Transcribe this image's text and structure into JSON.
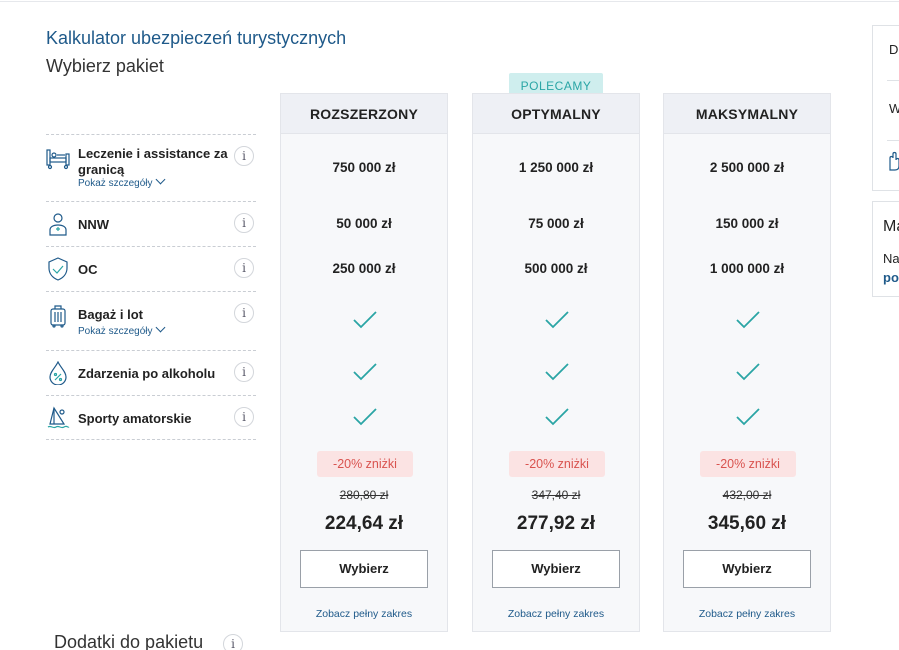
{
  "header": {
    "calculator_title": "Kalkulator ubezpieczeń turystycznych",
    "choose_package": "Wybierz pakiet"
  },
  "features": [
    {
      "label": "Leczenie i assistance za granicą",
      "more": "Pokaż szczegóły",
      "icon": "hospital-bed-icon",
      "info": "i"
    },
    {
      "label": "NNW",
      "icon": "person-injury-icon",
      "info": "i"
    },
    {
      "label": "OC",
      "icon": "shield-check-icon",
      "info": "i"
    },
    {
      "label": "Bagaż i lot",
      "more": "Pokaż szczegóły",
      "icon": "suitcase-icon",
      "info": "i"
    },
    {
      "label": "Zdarzenia po alkoholu",
      "icon": "drop-percent-icon",
      "info": "i"
    },
    {
      "label": "Sporty amatorskie",
      "icon": "windsurfer-icon",
      "info": "i"
    }
  ],
  "recommended_badge": "POLECAMY",
  "packages": [
    {
      "name": "ROZSZERZONY",
      "treatment": "750 000 zł",
      "nnw": "50 000 zł",
      "oc": "250 000 zł",
      "discount": "-20% zniżki",
      "old_price": "280,80 zł",
      "price": "224,64 zł",
      "button": "Wybierz",
      "range_link": "Zobacz pełny zakres"
    },
    {
      "name": "OPTYMALNY",
      "treatment": "1 250 000 zł",
      "nnw": "75 000 zł",
      "oc": "500 000 zł",
      "discount": "-20% zniżki",
      "old_price": "347,40 zł",
      "price": "277,92 zł",
      "button": "Wybierz",
      "range_link": "Zobacz pełny zakres"
    },
    {
      "name": "MAKSYMALNY",
      "treatment": "2 500 000 zł",
      "nnw": "150 000 zł",
      "oc": "1 000 000 zł",
      "discount": "-20% zniżki",
      "old_price": "432,00 zł",
      "price": "345,60 zł",
      "button": "Wybierz",
      "range_link": "Zobacz pełny zakres"
    }
  ],
  "addons": {
    "title": "Dodatki do pakietu",
    "info": "i"
  },
  "right_panel": {
    "row1": "D",
    "row2": "W",
    "panel2_title": "Ma",
    "panel2_text": "Na",
    "panel2_link": "po"
  },
  "colors": {
    "accent_blue": "#1f5a8a",
    "check_teal": "#2aa5a5",
    "discount_red": "#d9534f",
    "discount_bg": "#fbe3e3",
    "badge_bg": "#cfeeee"
  }
}
